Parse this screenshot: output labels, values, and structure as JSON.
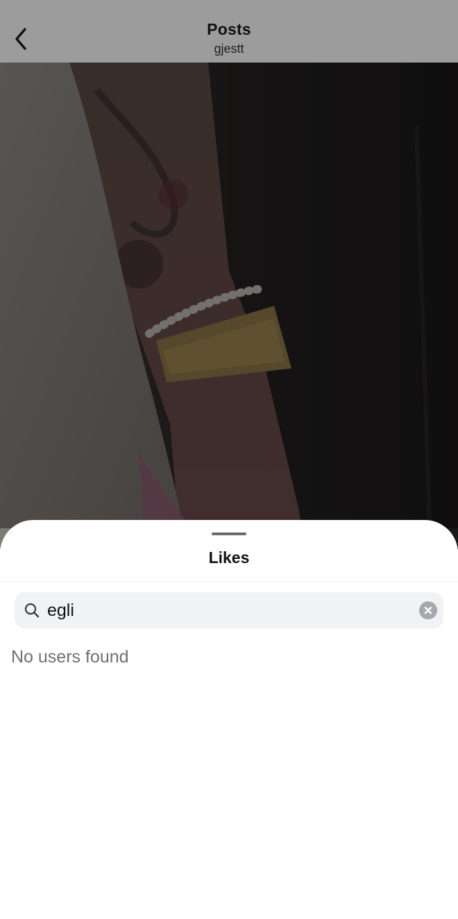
{
  "nav": {
    "title": "Posts",
    "subtitle": "gjestt",
    "back_icon": "chevron-left-icon"
  },
  "media": {
    "alt": "post-photo"
  },
  "likes_sheet": {
    "title": "Likes",
    "search": {
      "value": "egli",
      "placeholder": "Search",
      "search_icon": "search-icon",
      "clear_icon": "clear-icon"
    },
    "empty_message": "No users found"
  },
  "colors": {
    "nav_dim": "#9c9c9c",
    "search_bg": "#f1f2f4",
    "muted_text": "#6c6f75"
  }
}
